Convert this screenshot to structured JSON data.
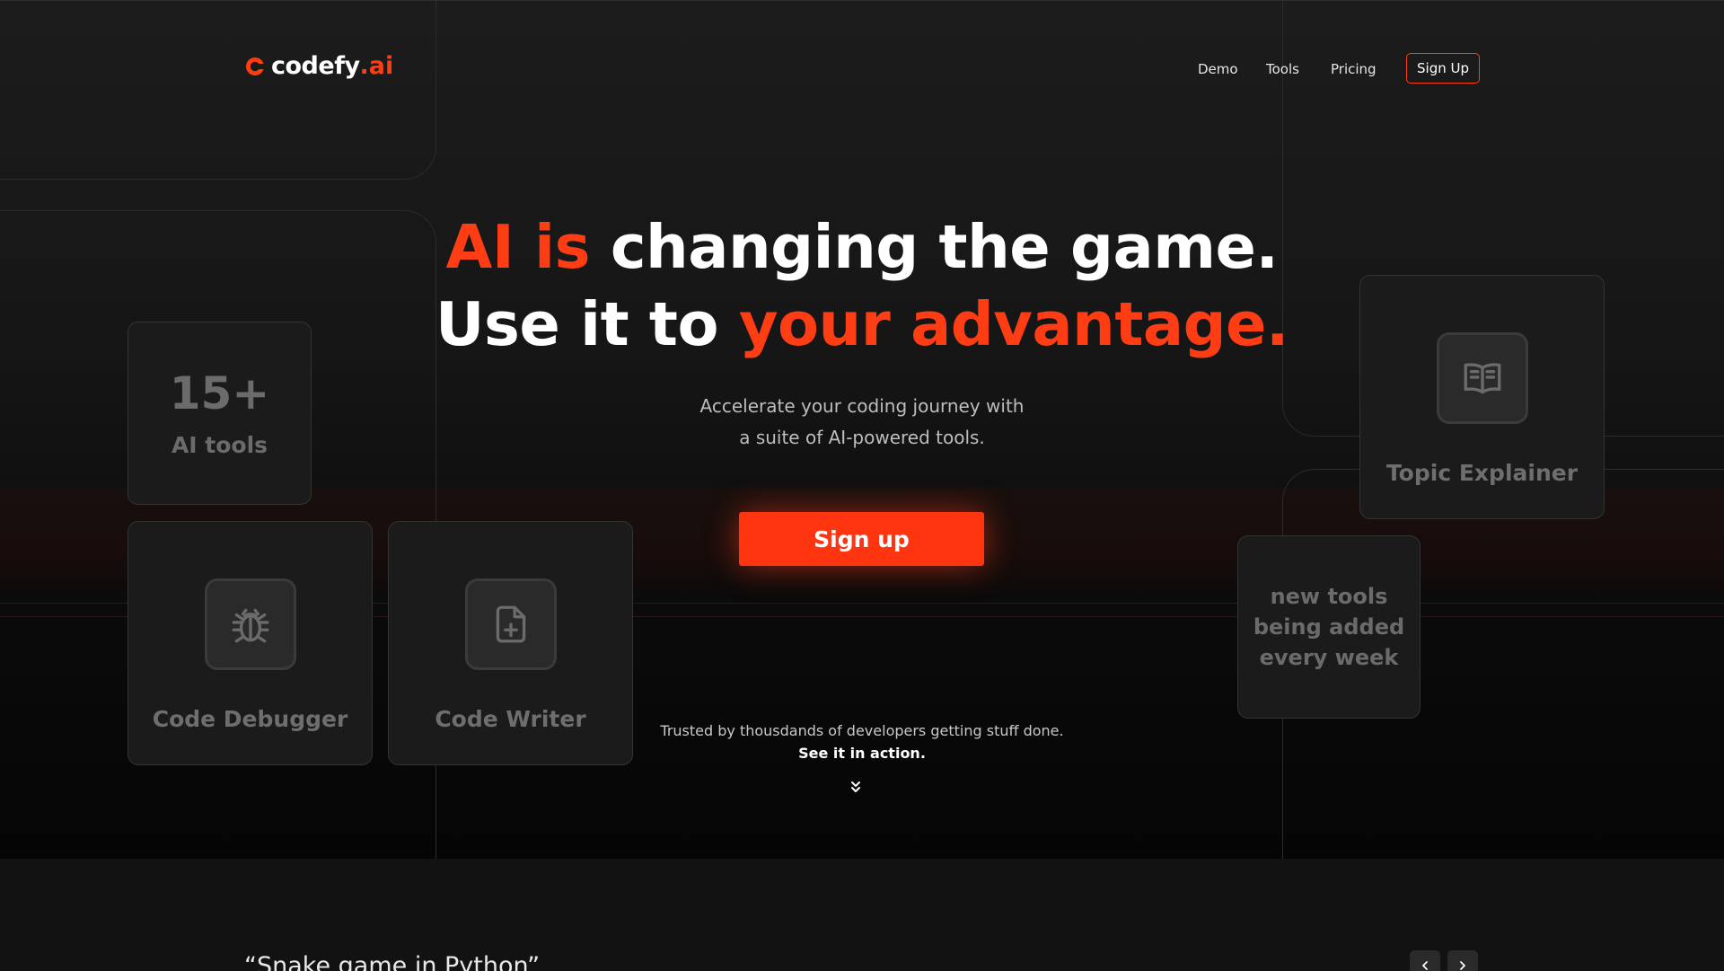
{
  "brand": {
    "name": "codefy",
    "suffix": ".ai",
    "accent_color": "#ff3d15"
  },
  "nav": {
    "links": [
      "Demo",
      "Tools",
      "Pricing"
    ],
    "signup_label": "Sign Up"
  },
  "hero": {
    "line1_accent": "AI is",
    "line1_rest": " changing the game.",
    "line2_start": "Use it to ",
    "line2_accent": "your advantage.",
    "subtitle_1": "Accelerate your coding journey with",
    "subtitle_2": "a suite of AI-powered tools.",
    "cta_label": "Sign up",
    "trust_line": "Trusted by thousdands of developers getting stuff done.",
    "see_action": "See it in action."
  },
  "cards": {
    "stat_value": "15+",
    "stat_label": "AI tools",
    "debugger_label": "Code Debugger",
    "writer_label": "Code Writer",
    "explainer_label": "Topic Explainer",
    "new_tools_1": "new tools",
    "new_tools_2": "being added",
    "new_tools_3": "every week"
  },
  "icons": {
    "logo": "logo-c-icon",
    "debugger": "bug-icon",
    "writer": "file-plus-icon",
    "explainer": "book-open-icon",
    "scroll": "chevrons-down-icon",
    "prev": "chevron-left-icon",
    "next": "chevron-right-icon"
  },
  "demo": {
    "quote": "“Snake game in Python”"
  }
}
